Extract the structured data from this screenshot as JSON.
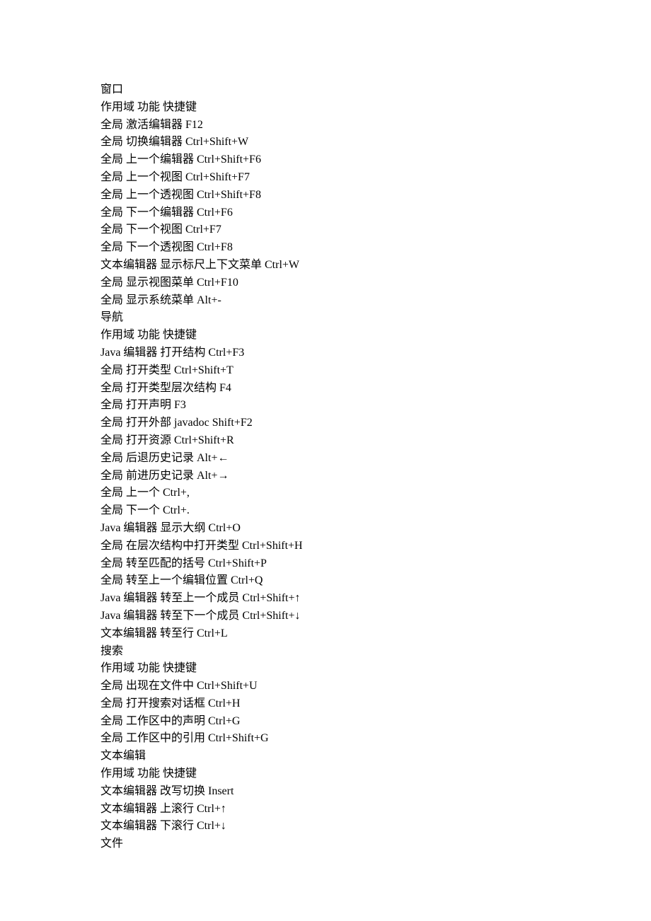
{
  "lines": [
    "窗口",
    "作用域 功能 快捷键",
    "全局 激活编辑器 F12",
    "全局 切换编辑器 Ctrl+Shift+W",
    "全局 上一个编辑器 Ctrl+Shift+F6",
    "全局 上一个视图 Ctrl+Shift+F7",
    "全局 上一个透视图 Ctrl+Shift+F8",
    "全局 下一个编辑器 Ctrl+F6",
    "全局 下一个视图 Ctrl+F7",
    "全局 下一个透视图 Ctrl+F8",
    "文本编辑器 显示标尺上下文菜单 Ctrl+W",
    "全局 显示视图菜单 Ctrl+F10",
    "全局 显示系统菜单 Alt+-",
    "导航",
    "作用域 功能 快捷键",
    "Java 编辑器 打开结构 Ctrl+F3",
    "全局 打开类型 Ctrl+Shift+T",
    "全局 打开类型层次结构 F4",
    "全局 打开声明 F3",
    "全局 打开外部 javadoc Shift+F2",
    "全局 打开资源 Ctrl+Shift+R",
    "全局 后退历史记录 Alt+←",
    "全局 前进历史记录 Alt+→",
    "全局 上一个 Ctrl+,",
    "全局 下一个 Ctrl+.",
    "Java 编辑器 显示大纲 Ctrl+O",
    "全局 在层次结构中打开类型 Ctrl+Shift+H",
    "全局 转至匹配的括号 Ctrl+Shift+P",
    "全局 转至上一个编辑位置 Ctrl+Q",
    "Java 编辑器 转至上一个成员 Ctrl+Shift+↑",
    "Java 编辑器 转至下一个成员 Ctrl+Shift+↓",
    "文本编辑器 转至行 Ctrl+L",
    "搜索",
    "作用域 功能 快捷键",
    "全局 出现在文件中 Ctrl+Shift+U",
    "全局 打开搜索对话框 Ctrl+H",
    "全局 工作区中的声明 Ctrl+G",
    "全局 工作区中的引用 Ctrl+Shift+G",
    "文本编辑",
    "作用域 功能 快捷键",
    "文本编辑器 改写切换 Insert",
    "文本编辑器 上滚行 Ctrl+↑",
    "文本编辑器 下滚行 Ctrl+↓",
    "文件"
  ]
}
